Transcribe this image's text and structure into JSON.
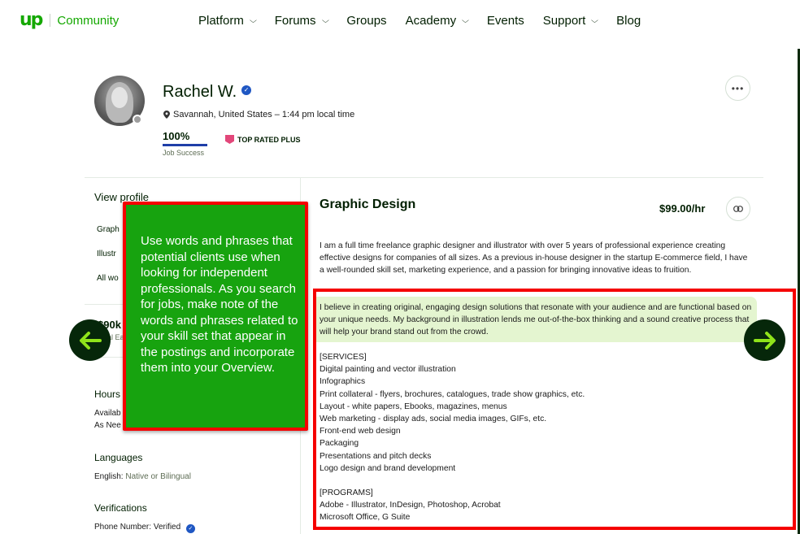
{
  "header": {
    "logo_mark": "up",
    "logo_text": "Community",
    "nav": [
      {
        "label": "Platform",
        "has_dropdown": true
      },
      {
        "label": "Forums",
        "has_dropdown": true
      },
      {
        "label": "Groups",
        "has_dropdown": false
      },
      {
        "label": "Academy",
        "has_dropdown": true
      },
      {
        "label": "Events",
        "has_dropdown": false
      },
      {
        "label": "Support",
        "has_dropdown": true
      },
      {
        "label": "Blog",
        "has_dropdown": false
      }
    ],
    "chevron": "⌄"
  },
  "profile": {
    "name": "Rachel W.",
    "verified_icon": "✓",
    "location": "Savannah, United States – 1:44 pm local time",
    "job_success_value": "100%",
    "job_success_pct": 100,
    "job_success_label": "Job Success",
    "badge": "TOP RATED PLUS",
    "more_label": "•••"
  },
  "sidebar": {
    "title": "View profile",
    "links": [
      "Graph",
      "Illustr",
      "All wo"
    ],
    "earnings_value": "$90k",
    "earnings_label": "Total Ea",
    "hours_title": "Hours",
    "hours_line1": "Availab",
    "hours_line2": "As Nee",
    "languages_title": "Languages",
    "language_name": "English:",
    "language_level": "Native or Bilingual",
    "verifications_title": "Verifications",
    "verification_label": "Phone Number:",
    "verification_value": "Verified"
  },
  "main": {
    "title": "Graphic Design",
    "rate": "$99.00/hr",
    "intro": "I am a full time freelance graphic designer and illustrator with over 5 years of professional experience creating effective designs for companies of all sizes. As a previous in-house designer in the startup E-commerce field, I have a well-rounded skill set, marketing experience, and a passion for bringing innovative ideas to fruition.",
    "highlight": "I believe in creating original, engaging design solutions that resonate with your audience and are functional based on your unique needs. My background in illustration lends me out-of-the-box thinking and a sound creative process that will help your brand stand out from the crowd.",
    "services_title": "[SERVICES]",
    "services": [
      "Digital painting and vector illustration",
      "Infographics",
      "Print collateral - flyers, brochures, catalogues, trade show graphics, etc.",
      "Layout - white papers, Ebooks, magazines, menus",
      "Web marketing - display ads, social media images, GIFs, etc.",
      "Front-end web design",
      "Packaging",
      "Presentations and pitch decks",
      "Logo design and brand development"
    ],
    "programs_title": "[PROGRAMS]",
    "programs": [
      "Adobe - Illustrator, InDesign, Photoshop, Acrobat",
      "Microsoft Office, G Suite"
    ]
  },
  "callout": {
    "text": "Use words and phrases that potential clients use when looking for independent professionals. As you search for jobs, make note of the words and phrases related to your skill set that appear in the postings and incorporate them into your Overview."
  },
  "colors": {
    "brand_green": "#14a800",
    "callout_green": "#17a30f",
    "annotation_red": "#f50000",
    "arrow_bg": "#06270a",
    "arrow_fg": "#8fe31a",
    "highlight_bg": "#e4f5d0",
    "verify_blue": "#1f57c3",
    "badge_pink": "#e2477a"
  }
}
